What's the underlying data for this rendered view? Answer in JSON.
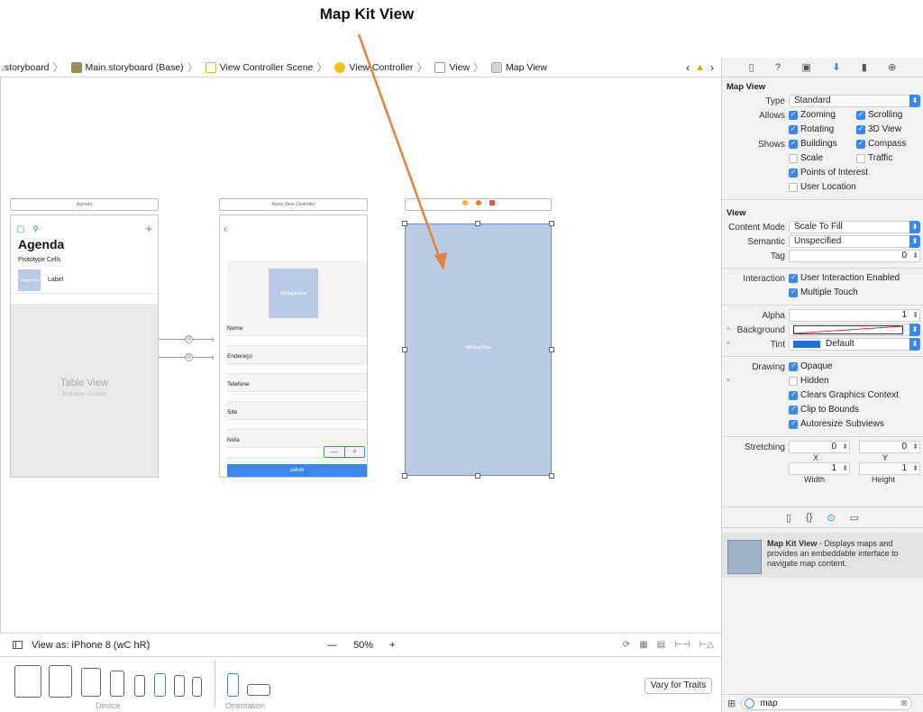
{
  "caption": "Map Kit View",
  "jumpbar": {
    "crumbs": [
      ".storyboard",
      "Main.storyboard (Base)",
      "View Controller Scene",
      "View Controller",
      "View",
      "Map View"
    ]
  },
  "canvas": {
    "agenda": {
      "scene_title": "Agenda",
      "title": "Agenda",
      "prototype_cells": "Prototype Cells",
      "cell_image": "imageView",
      "cell_label": "Label",
      "table_view": "Table View",
      "prototype_content": "Prototype Content"
    },
    "aluno": {
      "scene_title": "Aluno View Controller",
      "image_view": "UIImageView",
      "fields": [
        "Nome",
        "Endereço",
        "Telefone",
        "Site",
        "Nota"
      ],
      "stepper_minus": "—",
      "stepper_plus": "+",
      "save": "salvar"
    },
    "map": {
      "label": "MKMapView"
    }
  },
  "bottombar": {
    "view_as": "View as: iPhone 8 (wC hR)",
    "zoom_out": "—",
    "zoom": "50%",
    "zoom_in": "+"
  },
  "devicebar": {
    "device_caption": "Device",
    "orientation_caption": "Orientation",
    "vary_button": "Vary for Traits"
  },
  "inspector": {
    "map_view_title": "Map View",
    "type_label": "Type",
    "type_value": "Standard",
    "allows_label": "Allows",
    "shows_label": "Shows",
    "zooming": "Zooming",
    "scrolling": "Scrolling",
    "rotating": "Rotating",
    "view_3d": "3D View",
    "buildings": "Buildings",
    "compass": "Compass",
    "scale": "Scale",
    "traffic": "Traffic",
    "poi": "Points of Interest",
    "user_location": "User Location",
    "view_title": "View",
    "content_mode_label": "Content Mode",
    "content_mode_value": "Scale To Fill",
    "semantic_label": "Semantic",
    "semantic_value": "Unspecified",
    "tag_label": "Tag",
    "tag_value": "0",
    "interaction_label": "Interaction",
    "user_interaction": "User Interaction Enabled",
    "multiple_touch": "Multiple Touch",
    "alpha_label": "Alpha",
    "alpha_value": "1",
    "background_label": "Background",
    "tint_label": "Tint",
    "tint_value": "Default",
    "drawing_label": "Drawing",
    "opaque": "Opaque",
    "hidden": "Hidden",
    "clears_graphics": "Clears Graphics Context",
    "clip_bounds": "Clip to Bounds",
    "autoresize": "Autoresize Subviews",
    "stretching_label": "Stretching",
    "stretch_x": "0",
    "stretch_y": "0",
    "stretch_w": "1",
    "stretch_h": "1",
    "x_cap": "X",
    "y_cap": "Y",
    "width_cap": "Width",
    "height_cap": "Height",
    "lib_title": "Map Kit View",
    "lib_desc": " - Displays maps and provides an embeddable interface to navigate map content.",
    "filter_value": "map",
    "tint_color": "#1f6fe0"
  }
}
